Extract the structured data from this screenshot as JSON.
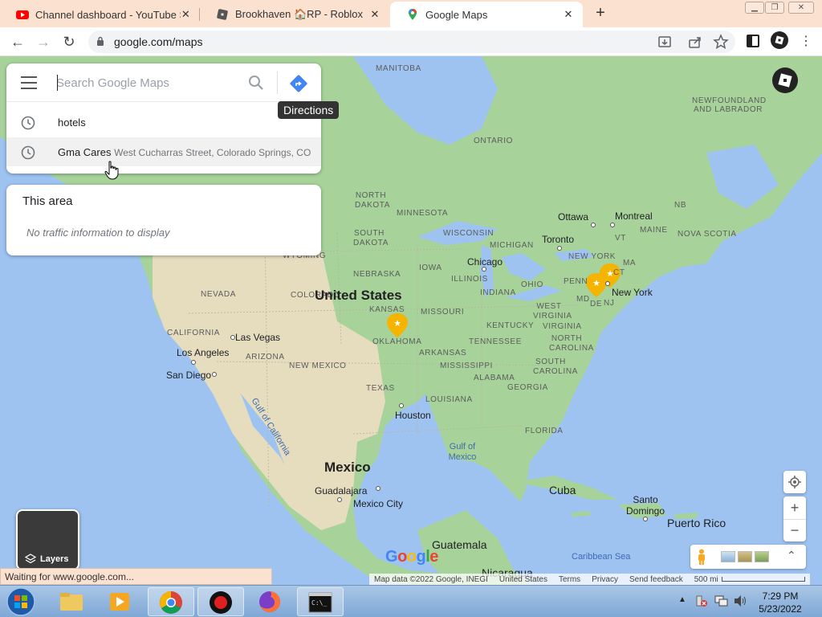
{
  "browser": {
    "tabs": [
      {
        "title": "Channel dashboard - YouTube Studio",
        "icon": "youtube-icon",
        "active": false
      },
      {
        "title": "Brookhaven 🏠RP - Roblox",
        "icon": "roblox-icon",
        "active": false
      },
      {
        "title": "Google Maps",
        "icon": "google-maps-icon",
        "active": true
      }
    ],
    "url": "google.com/maps",
    "status_text": "Waiting for www.google.com..."
  },
  "search": {
    "placeholder": "Search Google Maps",
    "tooltip": "Directions",
    "suggestions": [
      {
        "title": "hotels",
        "subtitle": ""
      },
      {
        "title": "Gma Cares",
        "subtitle": "West Cucharras Street, Colorado Springs, CO"
      }
    ]
  },
  "area_panel": {
    "title": "This area",
    "message": "No traffic information to display"
  },
  "map": {
    "countries": [
      "United States",
      "Mexico"
    ],
    "region_labels": [
      "MANITOBA",
      "ONTARIO",
      "NEWFOUNDLAND AND LABRADOR",
      "NORTH DAKOTA",
      "SOUTH DAKOTA",
      "MINNESOTA",
      "WISCONSIN",
      "MICHIGAN",
      "WYOMING",
      "NEBRASKA",
      "IOWA",
      "ILLINOIS",
      "INDIANA",
      "OHIO",
      "PENN",
      "NEW YORK",
      "VT",
      "MAINE",
      "NB",
      "NOVA SCOTIA",
      "MA",
      "CT",
      "MD",
      "DE",
      "NJ",
      "NEVADA",
      "COLORADO",
      "KANSAS",
      "MISSOURI",
      "KENTUCKY",
      "WEST VIRGINIA",
      "VIRGINIA",
      "CALIFORNIA",
      "ARIZONA",
      "NEW MEXICO",
      "OKLAHOMA",
      "ARKANSAS",
      "TENNESSEE",
      "NORTH CAROLINA",
      "SOUTH CAROLINA",
      "MISSISSIPPI",
      "ALABAMA",
      "GEORGIA",
      "TEXAS",
      "LOUISIANA",
      "FLORIDA"
    ],
    "cities": [
      "Ottawa",
      "Montreal",
      "Toronto",
      "Chicago",
      "New York",
      "Las Vegas",
      "Los Angeles",
      "San Diego",
      "Houston",
      "Guadalajara",
      "Mexico City",
      "Cuba",
      "Santo Domingo",
      "Puerto Rico",
      "Guatemala",
      "Nicaragua"
    ],
    "water_labels": [
      "Gulf of California",
      "Gulf of Mexico",
      "Caribbean Sea"
    ],
    "layers_label": "Layers",
    "attribution": [
      "Map data ©2022 Google, INEGI",
      "United States",
      "Terms",
      "Privacy",
      "Send feedback",
      "500 mi"
    ],
    "logo": "Google",
    "colors": {
      "water": "#9ec3f1",
      "land_green": "#a7d39b",
      "land_tan": "#e7dfc6",
      "pin": "#f4b400"
    }
  },
  "taskbar": {
    "time": "7:29 PM",
    "date": "5/23/2022"
  }
}
